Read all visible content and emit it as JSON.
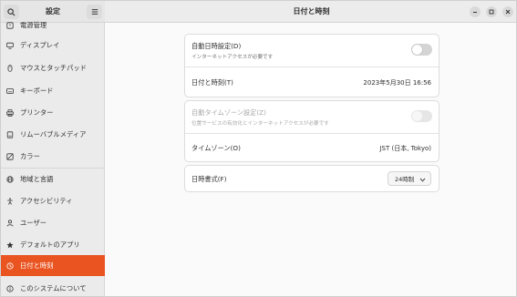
{
  "sidebar": {
    "title": "設定",
    "items": [
      {
        "label": "電源管理",
        "icon": "power-icon"
      },
      {
        "label": "ディスプレイ",
        "icon": "display-icon"
      },
      {
        "label": "マウスとタッチパッド",
        "icon": "mouse-icon"
      },
      {
        "label": "キーボード",
        "icon": "keyboard-icon"
      },
      {
        "label": "プリンター",
        "icon": "printer-icon"
      },
      {
        "label": "リムーバブルメディア",
        "icon": "removable-media-icon"
      },
      {
        "label": "カラー",
        "icon": "color-icon"
      },
      {
        "label": "地域と言語",
        "icon": "globe-icon"
      },
      {
        "label": "アクセシビリティ",
        "icon": "accessibility-icon"
      },
      {
        "label": "ユーザー",
        "icon": "users-icon"
      },
      {
        "label": "デフォルトのアプリ",
        "icon": "star-icon"
      },
      {
        "label": "日付と時刻",
        "icon": "clock-icon",
        "active": true
      },
      {
        "label": "このシステムについて",
        "icon": "info-icon"
      }
    ]
  },
  "header": {
    "title": "日付と時刻"
  },
  "settings": {
    "auto_datetime": {
      "title": "自動日時設定(D)",
      "subtitle": "インターネットアクセスが必要です",
      "enabled": false
    },
    "datetime": {
      "title": "日付と時刻(T)",
      "value": "2023年5月30日 16:56"
    },
    "auto_timezone": {
      "title": "自動タイムゾーン設定(Z)",
      "subtitle": "位置サービスの有効化とインターネットアクセスが必要です",
      "enabled": false,
      "disabled": true
    },
    "timezone": {
      "title": "タイムゾーン(O)",
      "value": "JST (日本, Tokyo)"
    },
    "time_format": {
      "title": "日時書式(F)",
      "value": "24時制"
    }
  },
  "colors": {
    "accent": "#e95420",
    "sidebar_bg": "#ebebeb",
    "content_bg": "#fafafa"
  }
}
